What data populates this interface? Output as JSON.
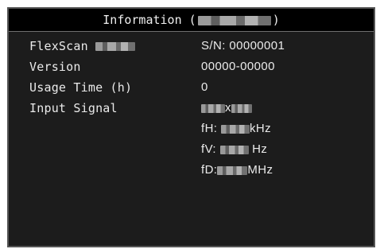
{
  "title": {
    "text": "Information (",
    "close": ")"
  },
  "rows": {
    "model_label": "FlexScan",
    "serial_value": "S/N: 00000001",
    "version_label": "Version",
    "version_value": "00000-00000",
    "usage_label": "Usage Time (h)",
    "usage_value": "0",
    "input_label": "Input Signal",
    "resolution_sep": "x",
    "fh_label": "fH:",
    "fh_unit": "kHz",
    "fv_label": "fV:",
    "fv_unit": "Hz",
    "fd_label": "fD:",
    "fd_unit": "MHz"
  }
}
